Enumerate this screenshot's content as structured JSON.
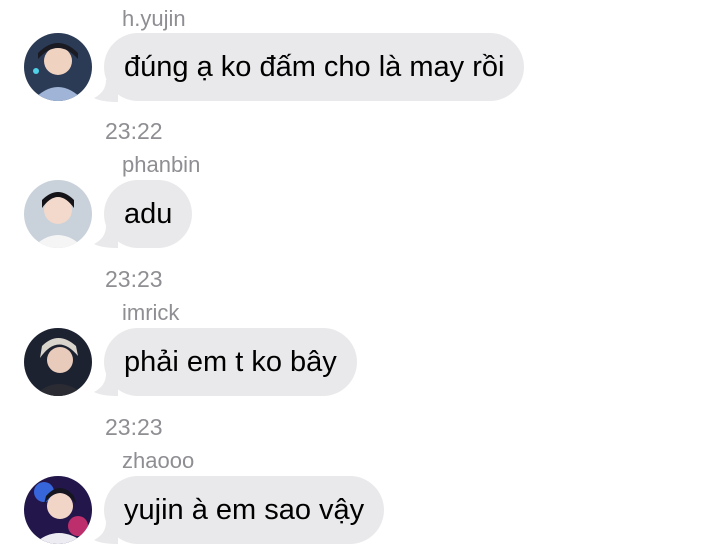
{
  "messages": [
    {
      "sender": "h.yujin",
      "text": "đúng ạ ko đấm cho là may rồi",
      "avatar": "avatar-icon-person",
      "time_after": "23:22"
    },
    {
      "sender": "phanbin",
      "text": "adu",
      "avatar": "avatar-icon-person",
      "time_after": "23:23"
    },
    {
      "sender": "imrick",
      "text": "phải em t ko bây",
      "avatar": "avatar-icon-person",
      "time_after": "23:23"
    },
    {
      "sender": "zhaooo",
      "text": "yujin à em sao vậy",
      "avatar": "avatar-icon-person"
    }
  ],
  "colors": {
    "bubble": "#e9e9eb",
    "meta_text": "#8e8e93",
    "background": "#ffffff"
  }
}
